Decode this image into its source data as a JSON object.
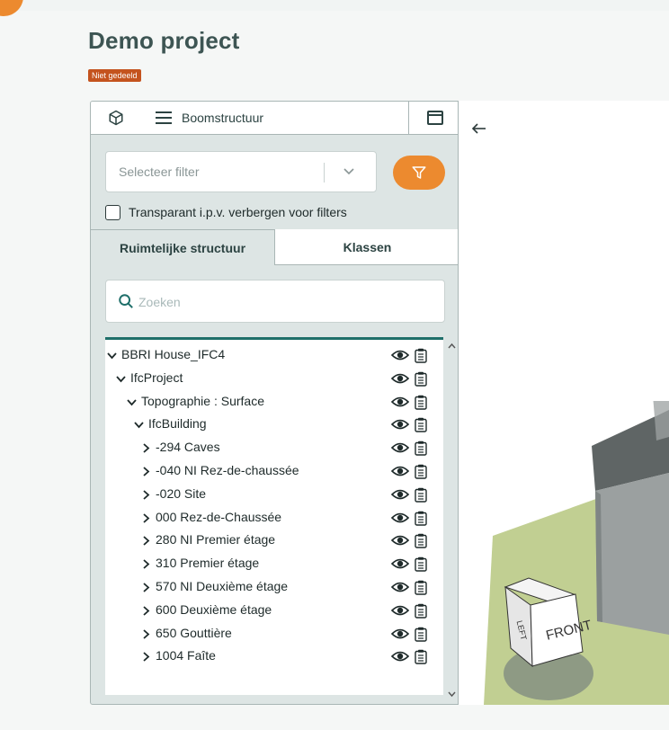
{
  "project": {
    "title": "Demo project",
    "badge": "Niet gedeeld"
  },
  "panel_tabs": {
    "model_icon": "cube-icon",
    "tree_label": "Boomstructuur",
    "tree_icon": "menu-icon",
    "window_icon": "window-icon"
  },
  "filter": {
    "placeholder": "Selecteer filter",
    "button_icon": "funnel-icon"
  },
  "transparent_option": {
    "label": "Transparant i.p.v. verbergen voor filters",
    "checked": false
  },
  "sub_tabs": {
    "active": "Ruimtelijke structuur",
    "other": "Klassen"
  },
  "search": {
    "placeholder": "Zoeken"
  },
  "tree": [
    {
      "label": "BBRI House_IFC4",
      "level": 0,
      "expanded": true
    },
    {
      "label": "IfcProject",
      "level": 1,
      "expanded": true
    },
    {
      "label": "Topographie : Surface",
      "level": 2,
      "expanded": true
    },
    {
      "label": "IfcBuilding",
      "level": 3,
      "expanded": true
    },
    {
      "label": "-294 Caves",
      "level": 4,
      "expanded": false
    },
    {
      "label": "-040 NI Rez-de-chaussée",
      "level": 4,
      "expanded": false
    },
    {
      "label": "-020 Site",
      "level": 4,
      "expanded": false
    },
    {
      "label": "000 Rez-de-Chaussée",
      "level": 4,
      "expanded": false
    },
    {
      "label": "280 NI Premier étage",
      "level": 4,
      "expanded": false
    },
    {
      "label": "310 Premier étage",
      "level": 4,
      "expanded": false
    },
    {
      "label": "570 NI Deuxième étage",
      "level": 4,
      "expanded": false
    },
    {
      "label": "600 Deuxième étage",
      "level": 4,
      "expanded": false
    },
    {
      "label": "650 Gouttière",
      "level": 4,
      "expanded": false
    },
    {
      "label": "1004 Faîte",
      "level": 4,
      "expanded": false
    }
  ],
  "viewer": {
    "back_icon": "arrow-left-icon",
    "navcube": {
      "front": "FRONT",
      "side": "LEFT"
    }
  },
  "colors": {
    "accent": "#ec8a2f",
    "badge": "#c4531e",
    "panel_bg": "#dde5e4",
    "tree_top": "#1f6f6a",
    "ground": "#c1cf92"
  }
}
